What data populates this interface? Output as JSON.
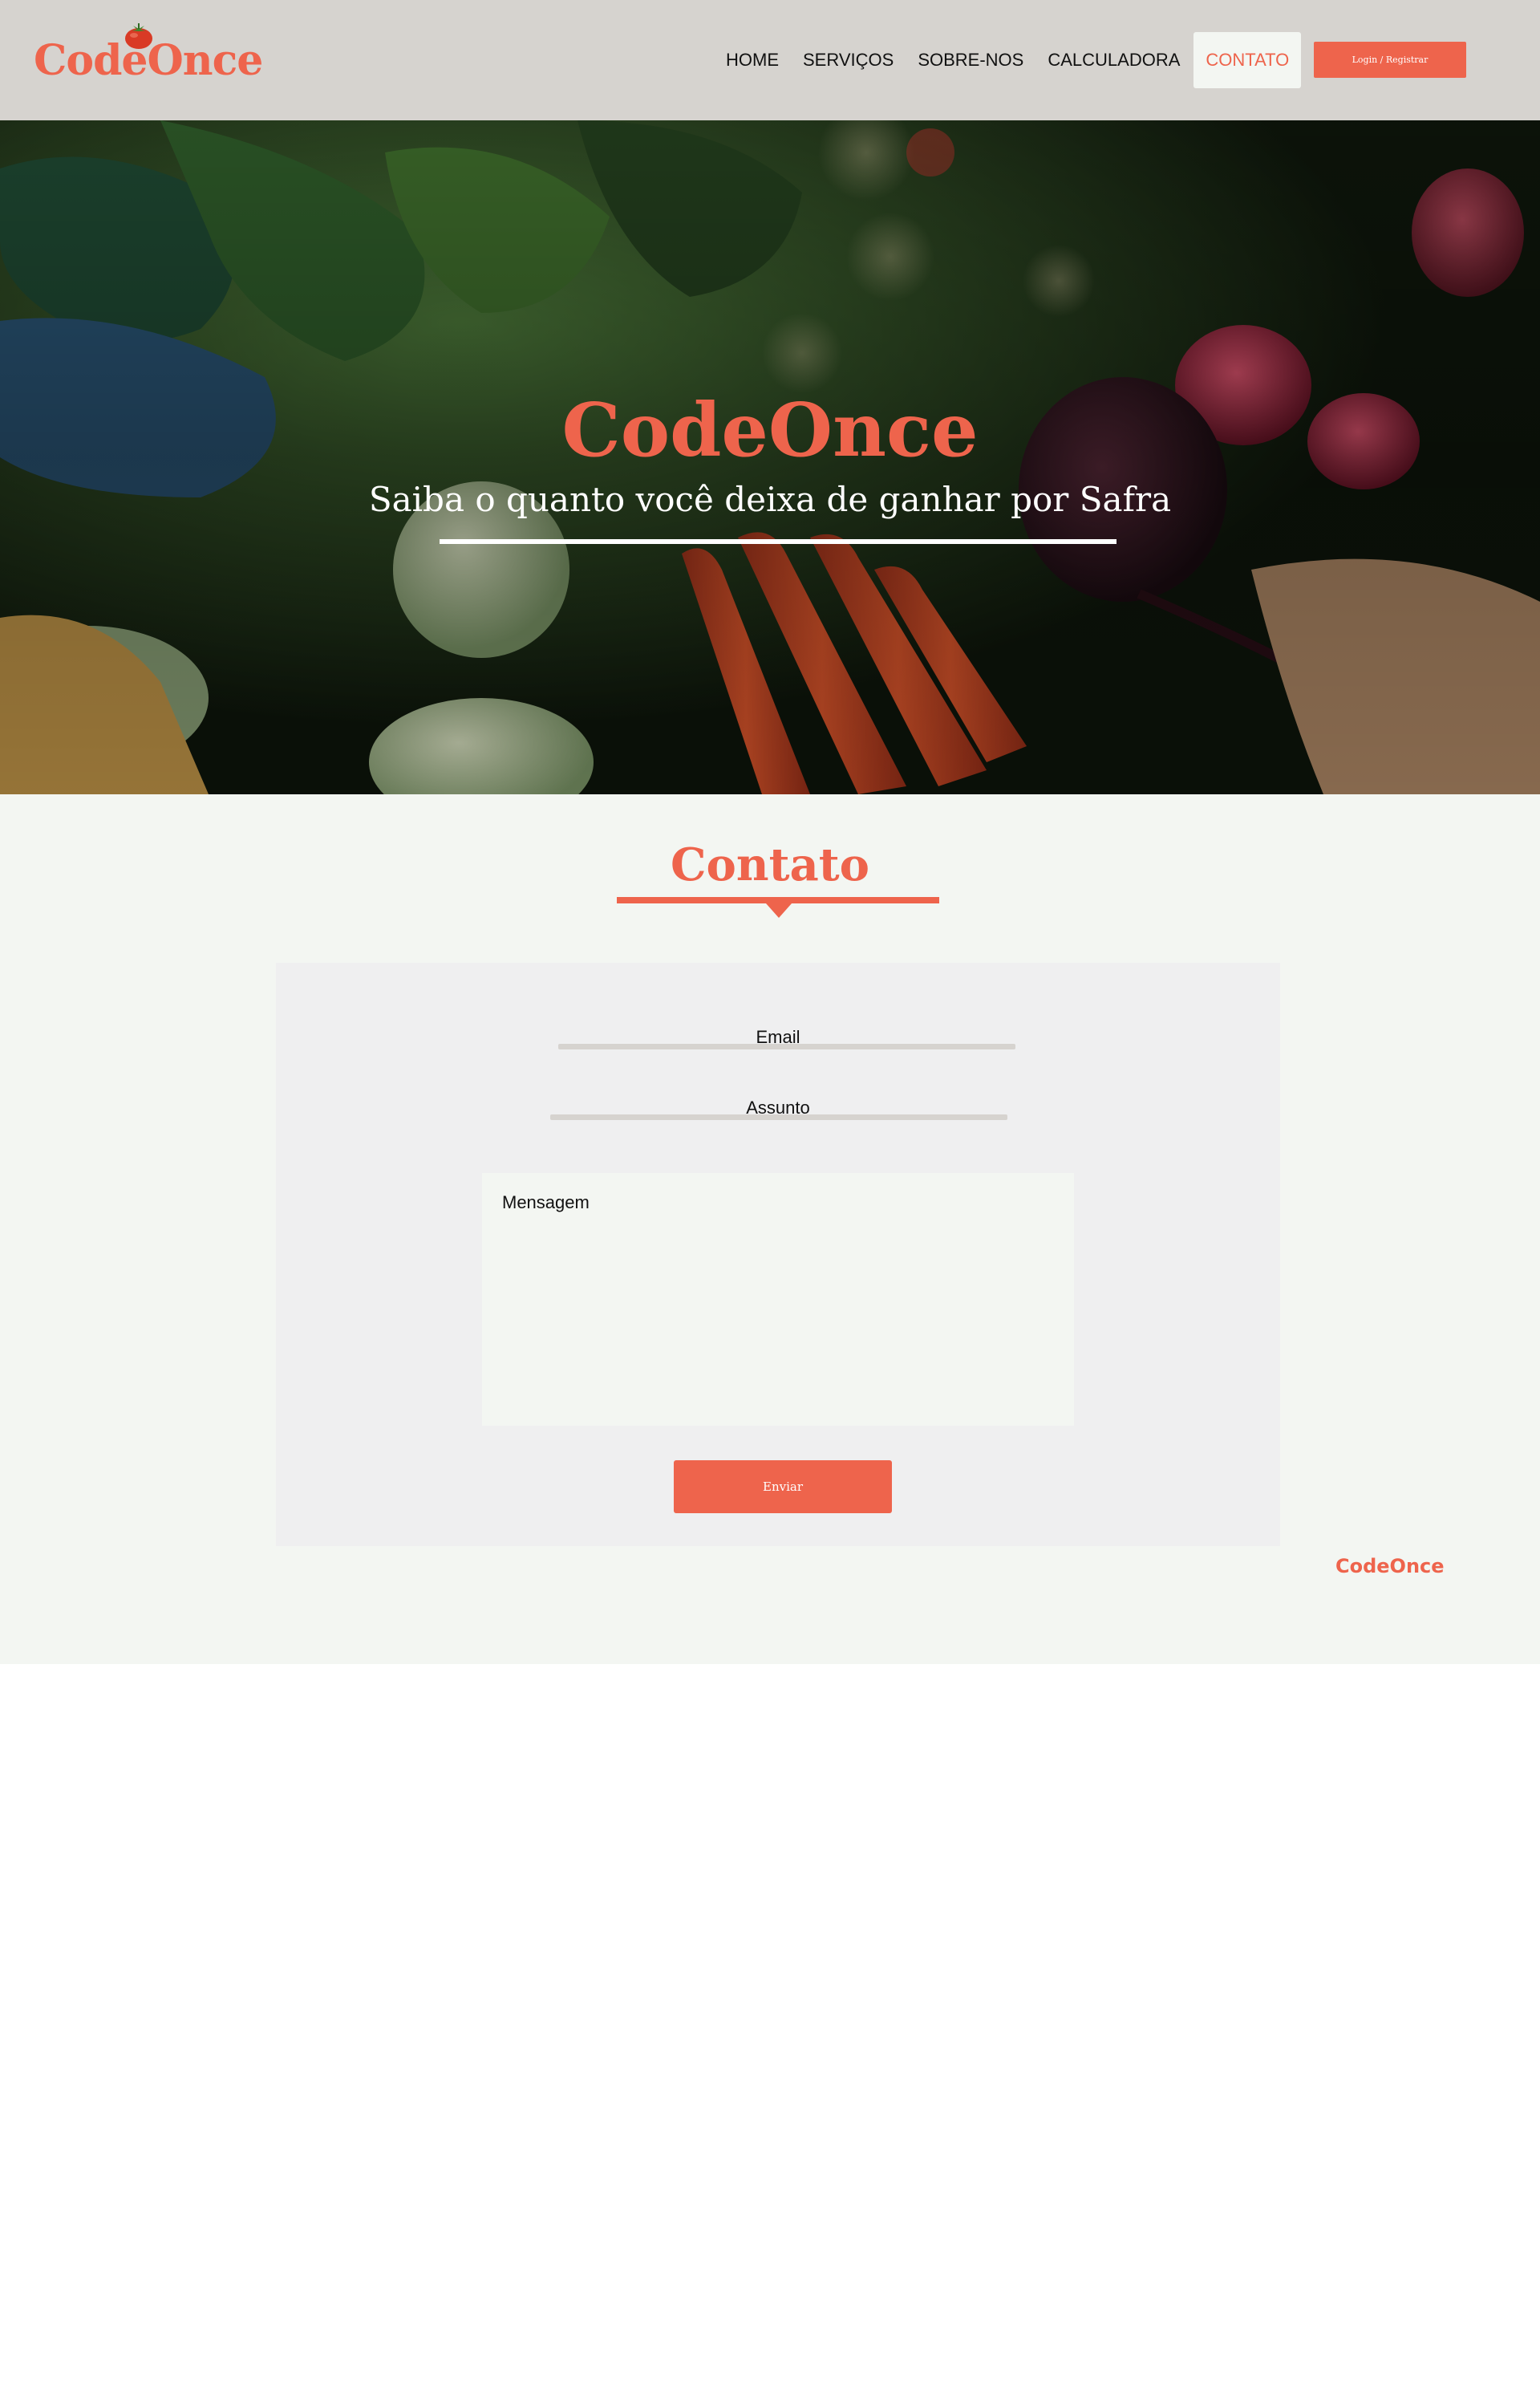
{
  "header": {
    "logo_text": "CodeOnce",
    "logo_icon": "tomato-icon",
    "nav": [
      {
        "label": "HOME"
      },
      {
        "label": "SERVIÇOS"
      },
      {
        "label": "SOBRE-NOS"
      },
      {
        "label": "CALCULADORA"
      },
      {
        "label": "CONTATO",
        "active": true
      }
    ],
    "login_label": "Login /  Registrar"
  },
  "hero": {
    "title": "CodeOnce",
    "subtitle": "Saiba o quanto você deixa de ganhar por Safra"
  },
  "contact": {
    "title": "Contato",
    "email_label": "Email",
    "subject_label": "Assunto",
    "message_placeholder": "Mensagem",
    "send_label": "Enviar"
  },
  "footer": {
    "brand": "CodeOnce"
  },
  "colors": {
    "accent": "#ee644c",
    "header_bg": "#d6d3cf",
    "section_bg": "#f3f6f2",
    "card_bg": "#efeff0"
  }
}
